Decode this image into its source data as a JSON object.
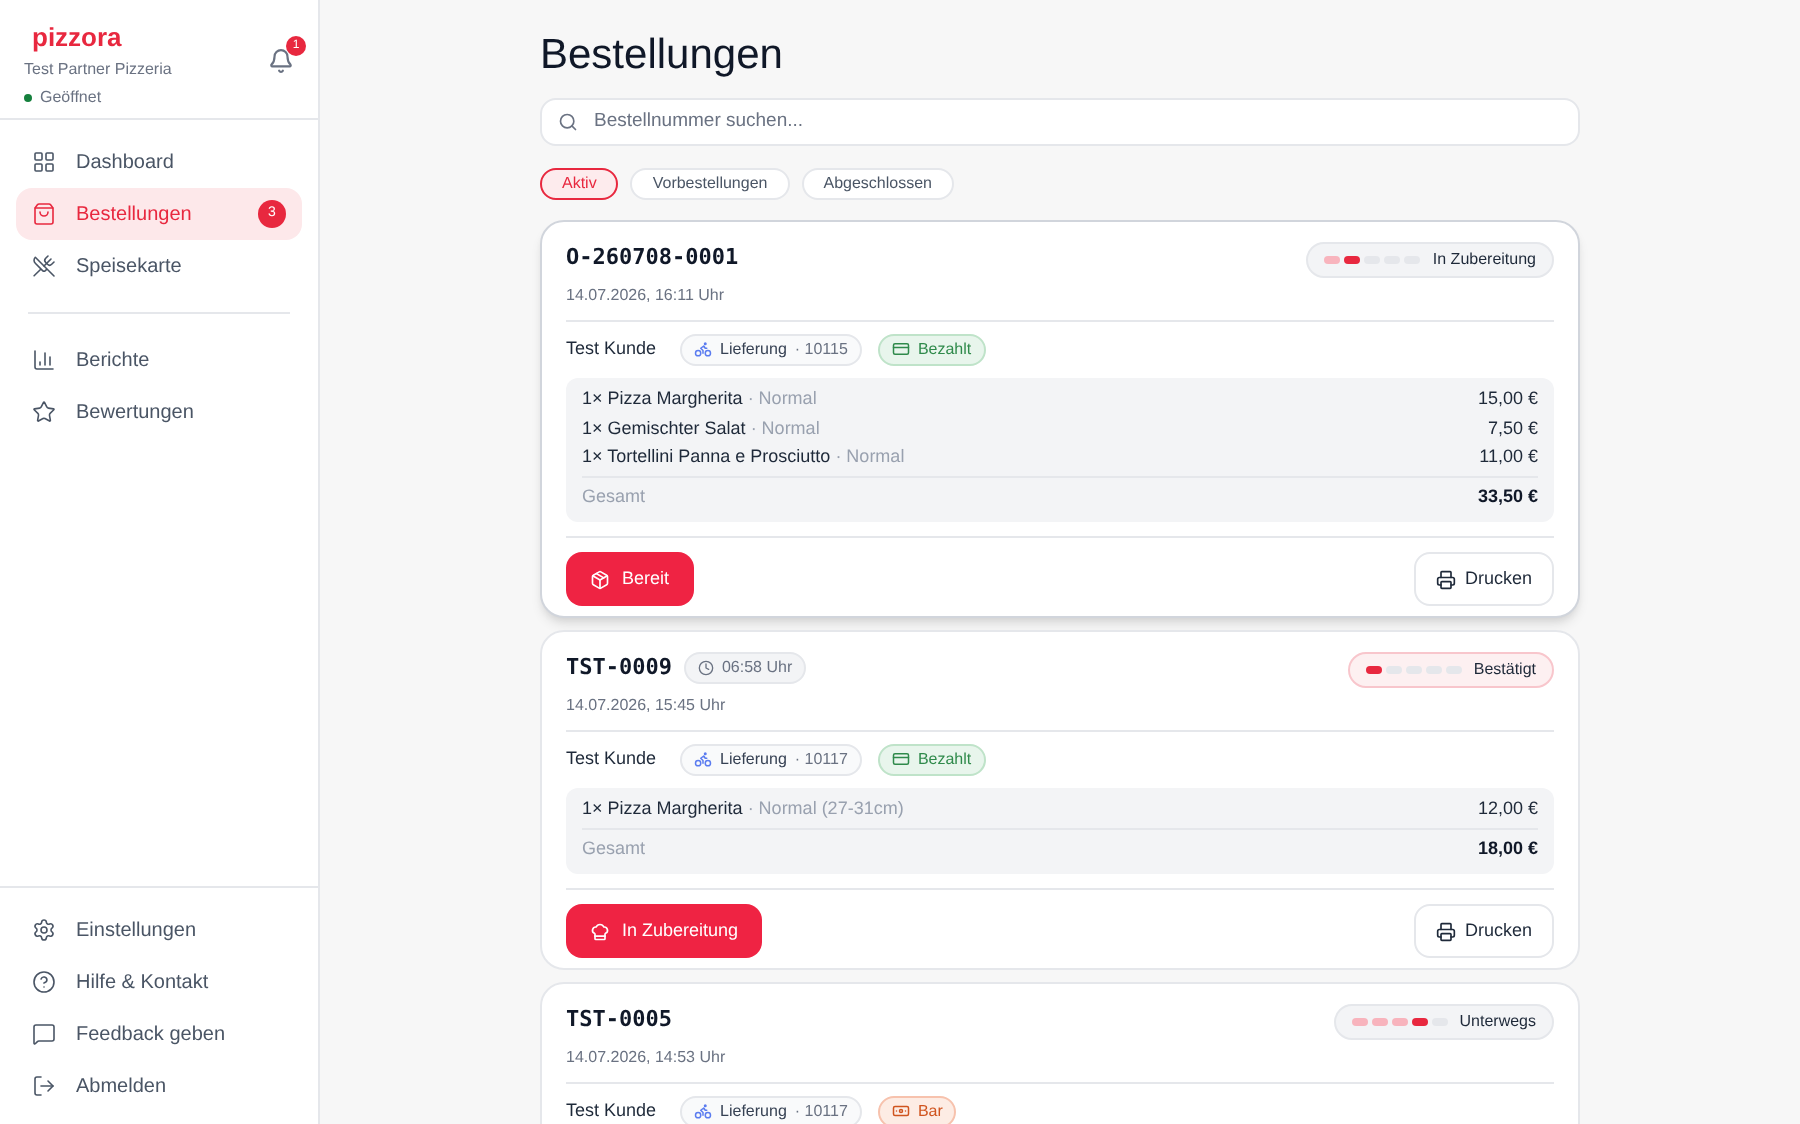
{
  "sidebar": {
    "brand": "pizzora",
    "partner": "Test Partner Pizzeria",
    "status": {
      "label": "Geöffnet",
      "color": "#15803d"
    },
    "notifications": "1",
    "main_items": [
      {
        "kind": "dashboard",
        "label": "Dashboard",
        "selected": false
      },
      {
        "kind": "orders",
        "label": "Bestellungen",
        "selected": true,
        "badge": "3"
      },
      {
        "kind": "menu",
        "label": "Speisekarte",
        "selected": false
      }
    ],
    "report_items": [
      {
        "kind": "reports",
        "label": "Berichte",
        "selected": false
      },
      {
        "kind": "reviews",
        "label": "Bewertungen",
        "selected": false
      }
    ],
    "footer_items": [
      {
        "kind": "settings",
        "label": "Einstellungen"
      },
      {
        "kind": "help",
        "label": "Hilfe & Kontakt"
      },
      {
        "kind": "feedback",
        "label": "Feedback geben"
      },
      {
        "kind": "logout",
        "label": "Abmelden"
      }
    ]
  },
  "page": {
    "title": "Bestellungen",
    "search": {
      "placeholder": "Bestellnummer suchen..."
    },
    "tabs": [
      {
        "label": "Aktiv",
        "selected": true
      },
      {
        "label": "Vorbestellungen",
        "selected": false
      },
      {
        "label": "Abgeschlossen",
        "selected": false
      }
    ]
  },
  "orders": [
    {
      "number": "O-260708-0001",
      "selected": true,
      "date": "14.07.2026, 16:11 Uhr",
      "status": "In Zubereitung",
      "steps": [
        {
          "done": true,
          "active": false
        },
        {
          "done": false,
          "active": true
        },
        {
          "done": false,
          "active": false
        },
        {
          "done": false,
          "active": false
        },
        {
          "done": false,
          "active": false
        }
      ],
      "customer": "Test Kunde",
      "delivery": "Lieferung",
      "zip": "· 10115",
      "payment": {
        "kind": "paid",
        "label": "Bezahlt"
      },
      "items": [
        {
          "name": "1× Pizza Margherita",
          "variant": "· Normal",
          "price": "15,00 €"
        },
        {
          "name": "1× Gemischter Salat",
          "variant": "· Normal",
          "price": "7,50 €"
        },
        {
          "name": "1× Tortellini Panna e Prosciutto",
          "variant": "· Normal",
          "price": "11,00 €"
        }
      ],
      "total_label": "Gesamt",
      "total": "33,50 €",
      "action": {
        "kind": "ready",
        "label": "Bereit"
      },
      "print": "Drucken"
    },
    {
      "number": "TST-0009",
      "selected": false,
      "time": "06:58 Uhr",
      "date": "14.07.2026, 15:45 Uhr",
      "status": "Bestätigt",
      "steps": [
        {
          "done": false,
          "active": true
        },
        {
          "done": false,
          "active": false
        },
        {
          "done": false,
          "active": false
        },
        {
          "done": false,
          "active": false
        },
        {
          "done": false,
          "active": false
        }
      ],
      "customer": "Test Kunde",
      "delivery": "Lieferung",
      "zip": "· 10117",
      "payment": {
        "kind": "paid",
        "label": "Bezahlt"
      },
      "items": [
        {
          "name": "1× Pizza Margherita",
          "variant": "· Normal (27-31cm)",
          "price": "12,00 €"
        }
      ],
      "total_label": "Gesamt",
      "total": "18,00 €",
      "action": {
        "kind": "cooking",
        "label": "In Zubereitung"
      },
      "print": "Drucken"
    },
    {
      "number": "TST-0005",
      "selected": false,
      "date": "14.07.2026, 14:53 Uhr",
      "status": "Unterwegs",
      "steps": [
        {
          "done": true,
          "active": false
        },
        {
          "done": true,
          "active": false
        },
        {
          "done": true,
          "active": false
        },
        {
          "done": false,
          "active": true
        },
        {
          "done": false,
          "active": false
        }
      ],
      "customer": "Test Kunde",
      "delivery": "Lieferung",
      "zip": "· 10117",
      "payment": {
        "kind": "cash",
        "label": "Bar"
      }
    }
  ]
}
